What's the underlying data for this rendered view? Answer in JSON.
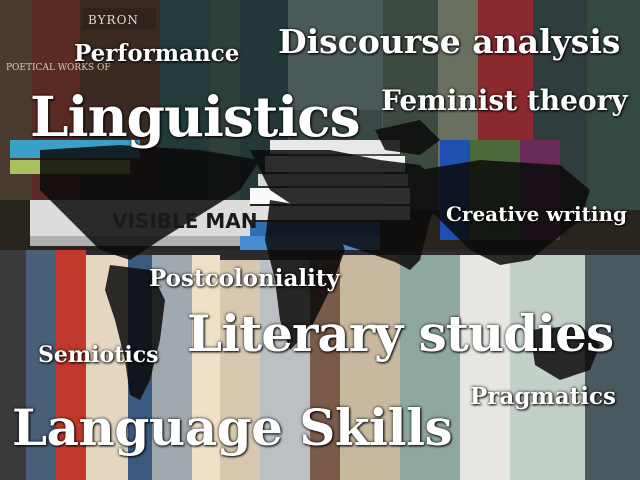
{
  "words": {
    "performance": "Performance",
    "discourse": "Discourse analysis",
    "linguistics": "Linguistics",
    "feminist": "Feminist theory",
    "creative": "Creative writing",
    "postcoloniality": "Postcoloniality",
    "literary": "Literary studies",
    "semiotics": "Semiotics",
    "pragmatics": "Pragmatics",
    "language": "Language Skills"
  },
  "book_spines": {
    "byron": "BYRON",
    "poetical_works": "POETICAL WORKS OF",
    "invisible_man": "VISIBLE MAN"
  },
  "colors": {
    "text": "#ffffff",
    "shelf_dark": "#1f1a17",
    "map_shadow": "#0b0b0b"
  }
}
